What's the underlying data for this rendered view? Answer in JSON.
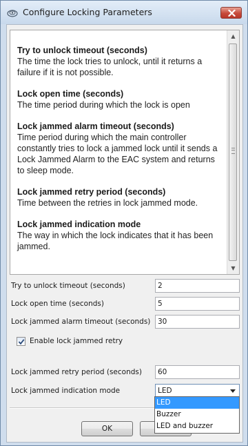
{
  "window": {
    "title": "Configure Locking Parameters",
    "icon": "lock-settings-icon",
    "close_icon": "close-icon"
  },
  "help": {
    "items": [
      {
        "title": "Try to unlock timeout (seconds)",
        "description": "The time the lock tries to unlock, until it returns a failure if it is not possible."
      },
      {
        "title": "Lock open time (seconds)",
        "description": "The time period during which the lock is open"
      },
      {
        "title": "Lock jammed alarm timeout (seconds)",
        "description": "Time period during which the main controller constantly tries to lock a jammed lock until it sends a Lock Jammed Alarm to the EAC system and returns to sleep mode."
      },
      {
        "title": "Lock jammed retry period (seconds)",
        "description": "Time between the retries in lock jammed mode."
      },
      {
        "title": "Lock jammed indication mode",
        "description": "The way in which the lock indicates that it has been jammed."
      }
    ]
  },
  "form": {
    "unlock_timeout": {
      "label": "Try to unlock timeout (seconds)",
      "value": "2"
    },
    "open_time": {
      "label": "Lock open time (seconds)",
      "value": "5"
    },
    "jammed_alarm_timeout": {
      "label": "Lock jammed alarm timeout (seconds)",
      "value": "30"
    },
    "enable_retry": {
      "label": "Enable lock jammed retry",
      "checked": true
    },
    "retry_period": {
      "label": "Lock jammed retry period (seconds)",
      "value": "60"
    },
    "indication_mode": {
      "label": "Lock jammed indication mode",
      "value": "LED",
      "options": [
        "LED",
        "Buzzer",
        "LED and buzzer"
      ],
      "highlighted_option": "LED"
    }
  },
  "buttons": {
    "ok": "OK",
    "cancel_visible": "Ca"
  },
  "colors": {
    "selection": "#3399ff",
    "close_button": "#c74a3a",
    "title_bar": "#d6e3f1"
  }
}
